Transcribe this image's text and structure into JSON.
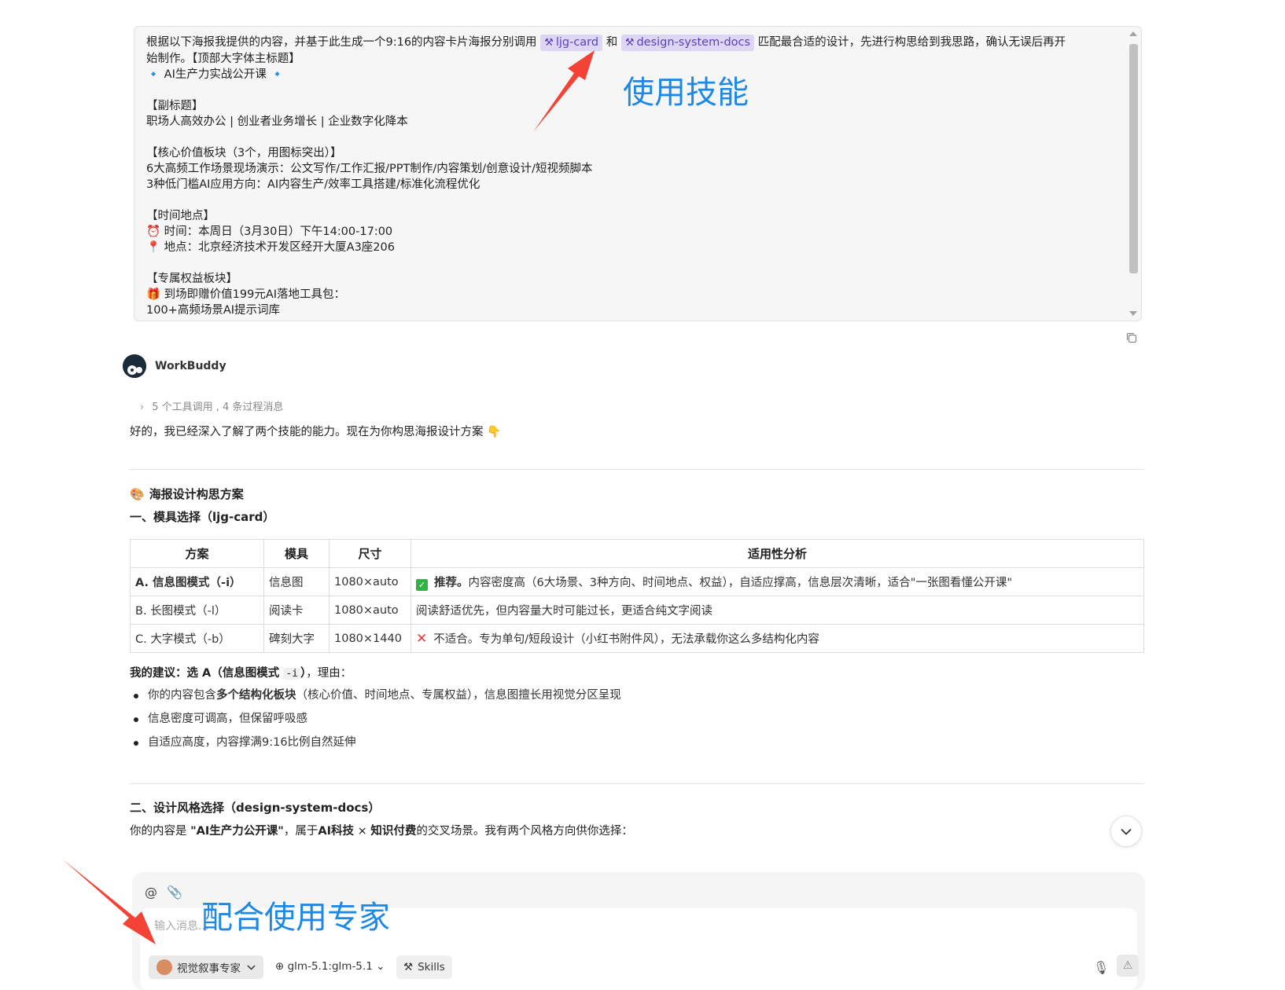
{
  "user_message": {
    "lines": [
      {
        "before": "根据以下海报我提供的内容，并基于此生成一个9:16的内容卡片海报分别调用 ",
        "chip1": "ljg-card",
        "middle": " 和 ",
        "chip2": "design-system-docs",
        "after": " 匹配最合适的设计，先进行构思给到我思路，确认无误后再开"
      },
      {
        "text": "始制作。【顶部大字体主标题】"
      },
      {
        "text": "🔹 AI生产力实战公开课 🔹"
      },
      {
        "text": ""
      },
      {
        "text": "【副标题】"
      },
      {
        "text": "职场人高效办公 | 创业者业务增长 | 企业数字化降本"
      },
      {
        "text": ""
      },
      {
        "text": "【核心价值板块（3个，用图标突出）】"
      },
      {
        "text": "6大高频工作场景现场演示：公文写作/工作汇报/PPT制作/内容策划/创意设计/短视频脚本"
      },
      {
        "text": "3种低门槛AI应用方向：AI内容生产/效率工具搭建/标准化流程优化"
      },
      {
        "text": ""
      },
      {
        "text": "【时间地点】"
      },
      {
        "text": "⏰ 时间：本周日（3月30日）下午14:00-17:00"
      },
      {
        "text": "📍 地点：北京经济技术开发区经开大厦A3座206"
      },
      {
        "text": ""
      },
      {
        "text": "【专属权益板块】"
      },
      {
        "text": "🎁 到场即赠价值199元AI落地工具包："
      },
      {
        "text": "100+高频场景AI提示词库"
      }
    ]
  },
  "annotations": {
    "skill": "使用技能",
    "expert": "配合使用专家"
  },
  "assistant": {
    "name": "WorkBuddy",
    "tool_summary": "5 个工具调用 , 4 条过程消息",
    "intro": "好的，我已经深入了解了两个技能的能力。现在为你构思海报设计方案 👇",
    "section_title": "海报设计构思方案",
    "subsection1": "一、模具选择（ljg-card）",
    "table": {
      "headers": [
        "方案",
        "模具",
        "尺寸",
        "适用性分析"
      ],
      "rows": [
        {
          "plan": "A. 信息图模式（-i）",
          "mold": "信息图",
          "size": "1080×auto",
          "tag": "推荐。",
          "analysis": "内容密度高（6大场景、3种方向、时间地点、权益），自适应撑高，信息层次清晰，适合\"一张图看懂公开课\""
        },
        {
          "plan": "B. 长图模式（-l）",
          "mold": "阅读卡",
          "size": "1080×auto",
          "tag": "",
          "analysis": "阅读舒适优先，但内容量大时可能过长，更适合纯文字阅读"
        },
        {
          "plan": "C. 大字模式（-b）",
          "mold": "碑刻大字",
          "size": "1080×1440",
          "tag": "",
          "analysis": "不适合。专为单句/短段设计（小红书附件风），无法承载你这么多结构化内容"
        }
      ]
    },
    "advice": {
      "label": "我的建议：选 A（信息图模式 ",
      "code": "-i",
      "label_end": "）",
      "suffix": "，理由："
    },
    "reasons": [
      {
        "before": "你的内容包含",
        "bold": "多个结构化板块",
        "after": "（核心价值、时间地点、专属权益），信息图擅长用视觉分区呈现"
      },
      {
        "before": "信息密度可调高，但保留呼吸感",
        "bold": "",
        "after": ""
      },
      {
        "before": "自适应高度，内容撑满9:16比例自然延伸",
        "bold": "",
        "after": ""
      }
    ],
    "subsection2": "二、设计风格选择（design-system-docs）",
    "style_desc": {
      "p1": "你的内容是 ",
      "b1": "\"AI生产力公开课\"",
      "p2": "，属于",
      "b2": "AI科技",
      "p3": " × ",
      "b3": "知识付费",
      "p4": "的交叉场景。我有两个风格方向供你选择："
    }
  },
  "composer": {
    "placeholder": "输入消息...",
    "expert_label": "视觉叙事专家",
    "model_label": "glm-5.1:glm-5.1",
    "skills_label": "Skills"
  },
  "colors": {
    "annotation": "#1e88e5",
    "arrow": "#f44336",
    "chip_bg": "#ddd6f5",
    "chip_text": "#5b3fb7"
  }
}
